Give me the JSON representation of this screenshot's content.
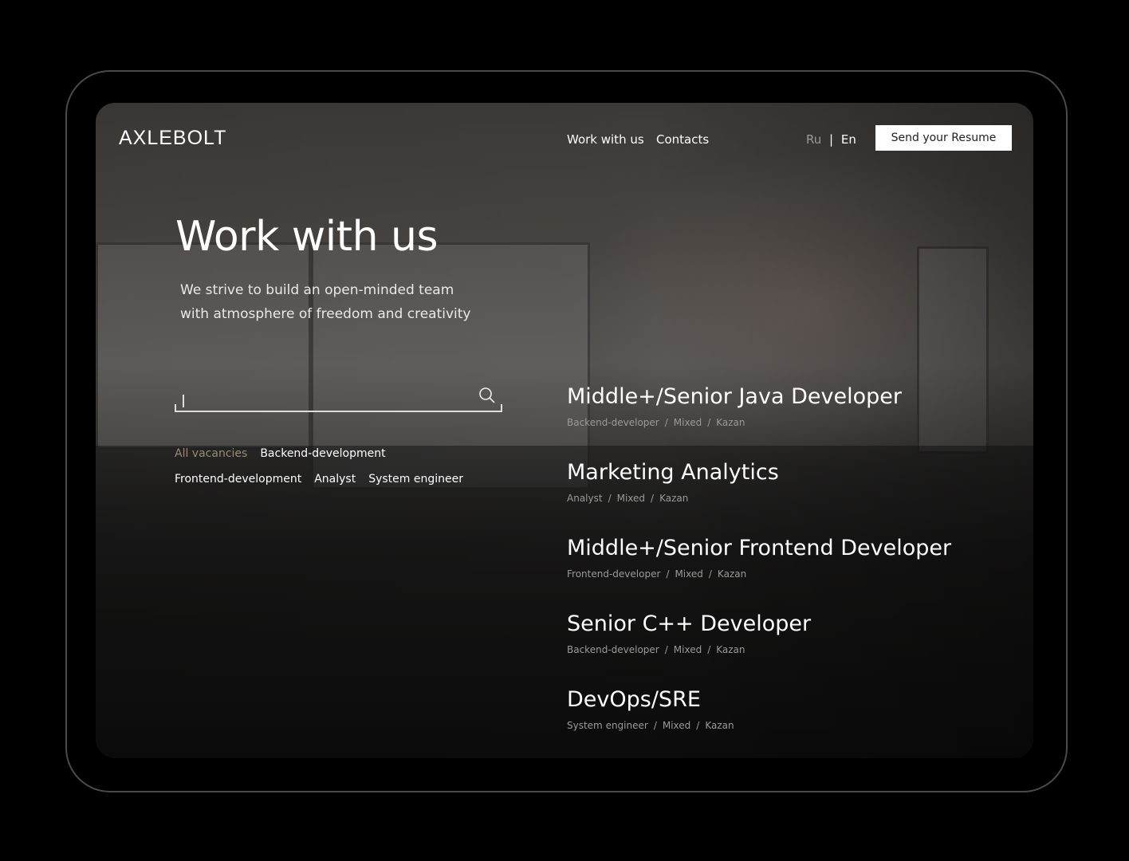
{
  "header": {
    "logo": "AXLEBOLT",
    "nav": [
      "Work with us",
      "Contacts"
    ],
    "lang": {
      "ru": "Ru",
      "sep": "|",
      "en": "En"
    },
    "resume_button": "Send your Resume"
  },
  "hero": {
    "title": "Work with us",
    "subtitle_line1": "We strive to build an open-minded team",
    "subtitle_line2": "with atmosphere of freedom and creativity"
  },
  "search": {
    "value": "",
    "placeholder": "",
    "icon": "search-icon"
  },
  "filters": [
    {
      "label": "All vacancies",
      "active": true
    },
    {
      "label": "Backend-development"
    },
    {
      "label": "Frontend-development"
    },
    {
      "label": "Analyst"
    },
    {
      "label": "System engineer"
    }
  ],
  "jobs": [
    {
      "title": "Middle+/Senior Java Developer",
      "category": "Backend-developer",
      "format": "Mixed",
      "city": "Kazan"
    },
    {
      "title": "Marketing Analytics",
      "category": "Analyst",
      "format": "Mixed",
      "city": "Kazan"
    },
    {
      "title": "Middle+/Senior Frontend Developer",
      "category": "Frontend-developer",
      "format": "Mixed",
      "city": "Kazan"
    },
    {
      "title": "Senior C++ Developer",
      "category": "Backend-developer",
      "format": "Mixed",
      "city": "Kazan"
    },
    {
      "title": "DevOps/SRE",
      "category": "System engineer",
      "format": "Mixed",
      "city": "Kazan"
    }
  ],
  "meta_separator": "/"
}
